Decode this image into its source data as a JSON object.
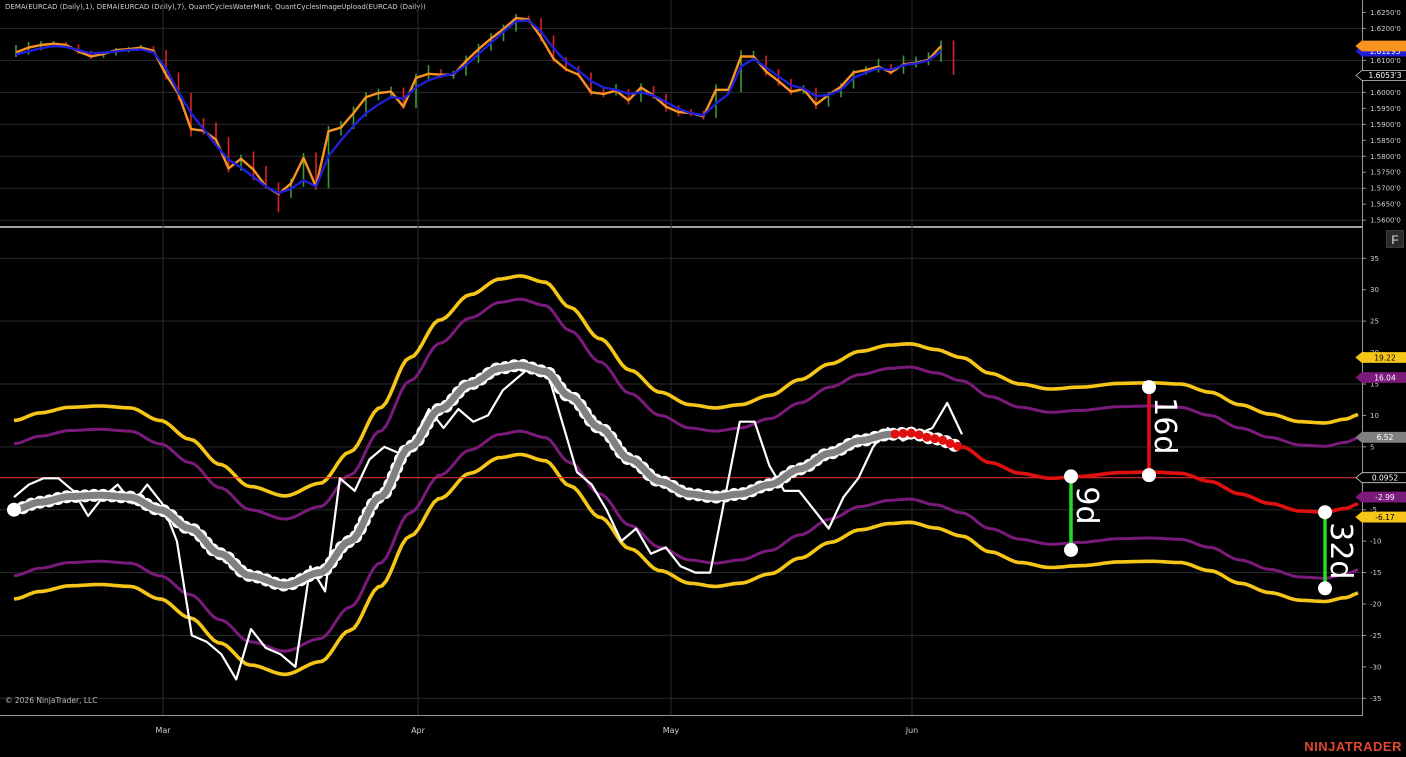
{
  "header": {
    "indicators_title": "DEMA(EURCAD (Daily),1), DEMA(EURCAD (Daily),7), QuantCyclesWaterMark, QuantCyclesImageUpload(EURCAD (Daily))"
  },
  "footer": {
    "copyright": "© 2026 NinjaTrader, LLC",
    "brand": "NINJATRADER"
  },
  "panel_button": {
    "label": "F"
  },
  "colors": {
    "background": "#000000",
    "grid": "#2b2b2b",
    "candle_up": "#3f9a3a",
    "candle_down": "#e02020",
    "dema_fast": "#f7931e",
    "dema_slow": "#1f1fd6",
    "band_outer": "#f5c518",
    "band_inner": "#7a1a7a",
    "cycle_line": "#808080",
    "cycle_projection": "#e01010",
    "oscillator": "#ffffff",
    "zero_line": "#d03030",
    "marker_red": "#e01010",
    "marker_green": "#22dd22"
  },
  "chart_data": [
    {
      "type": "line",
      "panel": "price",
      "x_axis": {
        "labels": [
          "Mar",
          "Apr",
          "May",
          "Jun"
        ]
      },
      "y_axis": {
        "ticks": [
          "1.6250'0",
          "1.6200'0",
          "1.6150'0",
          "1.6100'0",
          "1.6050'0",
          "1.6000'0",
          "1.5950'0",
          "1.5900'0",
          "1.5850'0",
          "1.5800'0",
          "1.5750'0",
          "1.5700'0",
          "1.5650'0",
          "1.5600'0"
        ],
        "tick_values": [
          1.625,
          1.62,
          1.615,
          1.61,
          1.605,
          1.6,
          1.595,
          1.59,
          1.585,
          1.58,
          1.575,
          1.57,
          1.565,
          1.56
        ],
        "range": [
          1.5585,
          1.627
        ]
      },
      "value_labels": [
        {
          "text": "1.61293",
          "value": 1.6129,
          "color": "#1f1fd6",
          "textColor": "#ffffff"
        },
        {
          "text": "1.6053'3",
          "value": 1.6053,
          "color": "#000000",
          "textColor": "#ffffff"
        },
        {
          "text": "",
          "value": 1.6145,
          "color": "#f7931e",
          "textColor": "#000000"
        }
      ],
      "series": [
        {
          "name": "DEMA(EURCAD (Daily),1)",
          "color": "#f7931e",
          "values": [
            1.6125,
            1.614,
            1.6148,
            1.6152,
            1.6148,
            1.6128,
            1.6112,
            1.612,
            1.6132,
            1.6135,
            1.614,
            1.613,
            1.6055,
            1.5995,
            1.5885,
            1.588,
            1.5852,
            1.5762,
            1.5792,
            1.5758,
            1.5705,
            1.5682,
            1.5715,
            1.5795,
            1.5705,
            1.5878,
            1.589,
            1.5935,
            1.5985,
            1.5998,
            1.6002,
            1.5955,
            1.6045,
            1.6058,
            1.6055,
            1.6055,
            1.6098,
            1.6135,
            1.6168,
            1.6198,
            1.6232,
            1.6228,
            1.6172,
            1.6105,
            1.6072,
            1.6055,
            1.6,
            1.5995,
            1.6005,
            1.5975,
            1.6015,
            1.599,
            1.5955,
            1.5938,
            1.5935,
            1.5925,
            1.6008,
            1.6008,
            1.6112,
            1.6112,
            1.6065,
            1.6035,
            1.6002,
            1.601,
            1.5962,
            1.5992,
            1.6018,
            1.6062,
            1.607,
            1.608,
            1.6062,
            1.6088,
            1.6092,
            1.6102,
            1.6145
          ]
        },
        {
          "name": "DEMA(EURCAD (Daily),7)",
          "color": "#1f1fd6",
          "values": [
            1.6118,
            1.6128,
            1.6138,
            1.6145,
            1.6142,
            1.6132,
            1.6122,
            1.6124,
            1.6128,
            1.6132,
            1.6134,
            1.6125,
            1.6075,
            1.6,
            1.5935,
            1.5885,
            1.5835,
            1.579,
            1.5765,
            1.5735,
            1.5705,
            1.5685,
            1.5698,
            1.5725,
            1.5705,
            1.58,
            1.585,
            1.5895,
            1.5935,
            1.5962,
            1.5985,
            1.598,
            1.6015,
            1.6038,
            1.605,
            1.6058,
            1.6085,
            1.612,
            1.6155,
            1.619,
            1.6222,
            1.6225,
            1.619,
            1.6138,
            1.6095,
            1.6068,
            1.6035,
            1.6015,
            1.6008,
            1.5995,
            1.6,
            1.599,
            1.597,
            1.5948,
            1.5935,
            1.5928,
            1.5965,
            1.5995,
            1.608,
            1.6105,
            1.6078,
            1.605,
            1.6022,
            1.6012,
            1.5988,
            1.5992,
            1.6008,
            1.6045,
            1.6062,
            1.6075,
            1.607,
            1.6085,
            1.609,
            1.61,
            1.6128
          ]
        }
      ],
      "candles": {
        "note": "OHLC bars as [open, high, low, close]",
        "ohlc": [
          [
            1.6115,
            1.6148,
            1.611,
            1.6125
          ],
          [
            1.6125,
            1.6158,
            1.6118,
            1.614
          ],
          [
            1.614,
            1.616,
            1.6132,
            1.6148
          ],
          [
            1.6148,
            1.616,
            1.614,
            1.6152
          ],
          [
            1.6152,
            1.6158,
            1.614,
            1.6148
          ],
          [
            1.6148,
            1.615,
            1.612,
            1.6128
          ],
          [
            1.6128,
            1.613,
            1.6105,
            1.6112
          ],
          [
            1.6112,
            1.6128,
            1.6108,
            1.612
          ],
          [
            1.612,
            1.6138,
            1.6115,
            1.6132
          ],
          [
            1.6132,
            1.6142,
            1.6125,
            1.6135
          ],
          [
            1.6135,
            1.6148,
            1.6132,
            1.614
          ],
          [
            1.614,
            1.6145,
            1.6122,
            1.613
          ],
          [
            1.613,
            1.6132,
            1.604,
            1.6055
          ],
          [
            1.6055,
            1.6062,
            1.5975,
            1.5995
          ],
          [
            1.5995,
            1.5998,
            1.5862,
            1.5885
          ],
          [
            1.5885,
            1.592,
            1.5868,
            1.588
          ],
          [
            1.588,
            1.5905,
            1.584,
            1.5852
          ],
          [
            1.5852,
            1.586,
            1.575,
            1.5762
          ],
          [
            1.5762,
            1.5805,
            1.5755,
            1.5792
          ],
          [
            1.5792,
            1.5815,
            1.5725,
            1.5758
          ],
          [
            1.5758,
            1.577,
            1.5698,
            1.5705
          ],
          [
            1.5705,
            1.5718,
            1.5625,
            1.5682
          ],
          [
            1.5682,
            1.573,
            1.567,
            1.5715
          ],
          [
            1.5715,
            1.581,
            1.5705,
            1.5795
          ],
          [
            1.5795,
            1.5812,
            1.5695,
            1.5705
          ],
          [
            1.5705,
            1.5895,
            1.57,
            1.5878
          ],
          [
            1.5878,
            1.591,
            1.5865,
            1.589
          ],
          [
            1.589,
            1.5955,
            1.5885,
            1.5935
          ],
          [
            1.5935,
            1.6,
            1.5925,
            1.5985
          ],
          [
            1.5985,
            1.6012,
            1.5975,
            1.5998
          ],
          [
            1.5998,
            1.6018,
            1.5985,
            1.6002
          ],
          [
            1.6002,
            1.6015,
            1.5948,
            1.5955
          ],
          [
            1.5955,
            1.6058,
            1.595,
            1.6045
          ],
          [
            1.6045,
            1.6085,
            1.604,
            1.6058
          ],
          [
            1.6058,
            1.6072,
            1.6045,
            1.6055
          ],
          [
            1.6055,
            1.6068,
            1.6042,
            1.6055
          ],
          [
            1.6055,
            1.6115,
            1.6052,
            1.6098
          ],
          [
            1.6098,
            1.6152,
            1.6092,
            1.6135
          ],
          [
            1.6135,
            1.6185,
            1.613,
            1.6168
          ],
          [
            1.6168,
            1.6212,
            1.616,
            1.6198
          ],
          [
            1.6198,
            1.6245,
            1.619,
            1.6232
          ],
          [
            1.6232,
            1.624,
            1.6218,
            1.6228
          ],
          [
            1.6228,
            1.6232,
            1.616,
            1.6172
          ],
          [
            1.6172,
            1.6178,
            1.6095,
            1.6105
          ],
          [
            1.6105,
            1.611,
            1.6065,
            1.6072
          ],
          [
            1.6072,
            1.6082,
            1.6048,
            1.6055
          ],
          [
            1.6055,
            1.6062,
            1.599,
            1.6
          ],
          [
            1.6,
            1.6018,
            1.5985,
            1.5995
          ],
          [
            1.5995,
            1.6025,
            1.599,
            1.6005
          ],
          [
            1.6005,
            1.601,
            1.5962,
            1.5975
          ],
          [
            1.5975,
            1.6028,
            1.597,
            1.6015
          ],
          [
            1.6015,
            1.602,
            1.598,
            1.599
          ],
          [
            1.599,
            1.5995,
            1.594,
            1.5955
          ],
          [
            1.5955,
            1.596,
            1.5925,
            1.5938
          ],
          [
            1.5938,
            1.5948,
            1.5925,
            1.5935
          ],
          [
            1.5935,
            1.5942,
            1.5915,
            1.5925
          ],
          [
            1.5925,
            1.6025,
            1.592,
            1.6008
          ],
          [
            1.6008,
            1.6018,
            1.5995,
            1.6008
          ],
          [
            1.6008,
            1.6132,
            1.6,
            1.6112
          ],
          [
            1.6112,
            1.613,
            1.6098,
            1.6112
          ],
          [
            1.6112,
            1.6115,
            1.6052,
            1.6065
          ],
          [
            1.6065,
            1.6072,
            1.602,
            1.6035
          ],
          [
            1.6035,
            1.6042,
            1.5992,
            1.6002
          ],
          [
            1.6002,
            1.6022,
            1.5995,
            1.601
          ],
          [
            1.601,
            1.6015,
            1.5948,
            1.5962
          ],
          [
            1.5962,
            1.6,
            1.5955,
            1.5992
          ],
          [
            1.5992,
            1.6028,
            1.5985,
            1.6018
          ],
          [
            1.6018,
            1.607,
            1.6012,
            1.6062
          ],
          [
            1.6062,
            1.6082,
            1.6055,
            1.607
          ],
          [
            1.607,
            1.6105,
            1.6062,
            1.608
          ],
          [
            1.608,
            1.6088,
            1.6055,
            1.6062
          ],
          [
            1.6062,
            1.6115,
            1.6058,
            1.6088
          ],
          [
            1.6088,
            1.6112,
            1.6078,
            1.6092
          ],
          [
            1.6092,
            1.6125,
            1.6085,
            1.6102
          ],
          [
            1.6102,
            1.6162,
            1.6095,
            1.6145
          ],
          [
            1.6145,
            1.6162,
            1.6055,
            1.6058
          ]
        ]
      }
    },
    {
      "type": "line",
      "panel": "cycle",
      "x_axis": {
        "labels": [
          "Mar",
          "Apr",
          "May",
          "Jun"
        ]
      },
      "y_axis": {
        "ticks": [
          "35",
          "30",
          "25",
          "20",
          "15",
          "10",
          "5",
          "0",
          "-5",
          "-10",
          "-15",
          "-20",
          "-25",
          "-30",
          "-35"
        ],
        "tick_values": [
          35,
          30,
          25,
          20,
          15,
          10,
          5,
          0,
          -5,
          -10,
          -15,
          -20,
          -25,
          -30,
          -35
        ],
        "range": [
          -37.5,
          39.5
        ]
      },
      "value_labels": [
        {
          "text": "19.22",
          "value": 19.22,
          "color": "#f5c518",
          "textColor": "#000000"
        },
        {
          "text": "16.04",
          "value": 16.04,
          "color": "#7a1a7a",
          "textColor": "#ffffff"
        },
        {
          "text": "6.52",
          "value": 6.52,
          "color": "#808080",
          "textColor": "#ffffff"
        },
        {
          "text": "0.0952",
          "value": 0.0952,
          "color": "#000000",
          "textColor": "#ffffff"
        },
        {
          "text": "-2.99",
          "value": -2.99,
          "color": "#7a1a7a",
          "textColor": "#ffffff"
        },
        {
          "text": "-6.17",
          "value": -6.17,
          "color": "#f5c518",
          "textColor": "#000000"
        }
      ],
      "cycle_annotations": [
        {
          "label": "9d",
          "color": "#22dd22",
          "from": [
            1071,
            0.3
          ],
          "to": [
            1071,
            -11.4
          ]
        },
        {
          "label": "16d",
          "color": "#e01010",
          "from": [
            1149,
            14.5
          ],
          "to": [
            1149,
            0.5
          ]
        },
        {
          "label": "32d",
          "color": "#22dd22",
          "from": [
            1325,
            -5.4
          ],
          "to": [
            1325,
            -17.5
          ]
        }
      ],
      "series": [
        {
          "name": "",
          "color": "#ffffff",
          "role": "oscillator",
          "values": [
            -3,
            -1,
            0,
            0,
            -2,
            -6,
            -3,
            -1,
            -4,
            -1,
            -4,
            -10,
            -25,
            -26,
            -28,
            -32,
            -24,
            -27,
            -28,
            -30,
            -14,
            -18,
            0,
            -2,
            3,
            5,
            4,
            6,
            11,
            8,
            11,
            9,
            10,
            14,
            16,
            18,
            17,
            9,
            1,
            -1,
            -5,
            -10,
            -8,
            -12,
            -11,
            -14,
            -15,
            -15,
            -3,
            9,
            9,
            2,
            -2,
            -2,
            -5,
            -8,
            -3,
            0,
            5,
            8,
            6,
            7,
            8,
            12,
            7
          ]
        }
      ]
    }
  ]
}
